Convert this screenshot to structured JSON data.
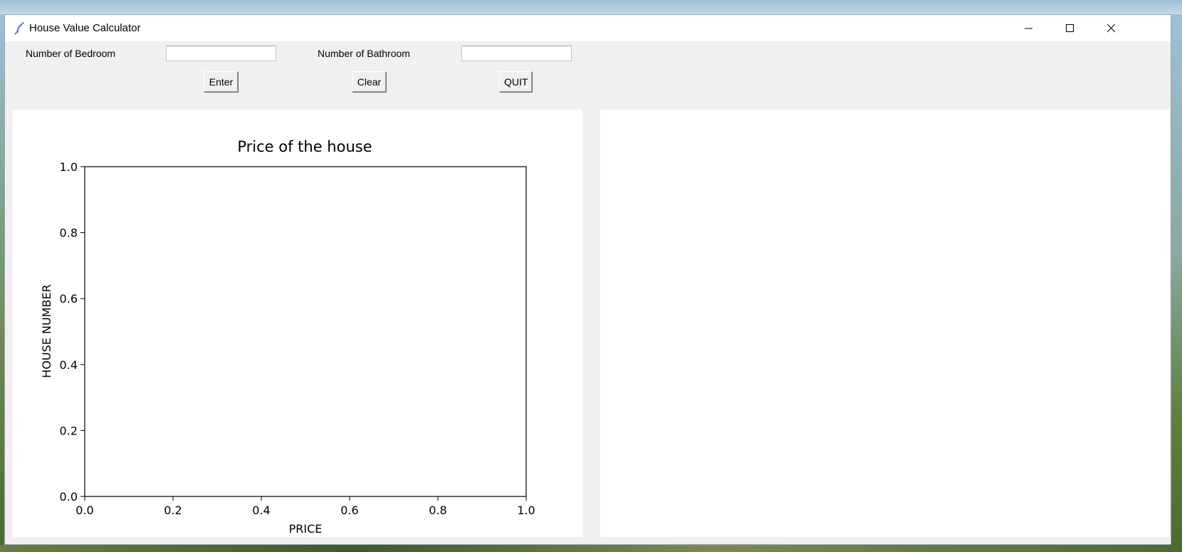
{
  "window": {
    "title": "House Value Calculator",
    "controls": [
      "minimize",
      "maximize",
      "close"
    ]
  },
  "form": {
    "bedroom_label": "Number of Bedroom",
    "bedroom_value": "",
    "bathroom_label": "Number of Bathroom",
    "bathroom_value": "",
    "enter_label": "Enter",
    "clear_label": "Clear",
    "quit_label": "QUIT"
  },
  "chart_data": {
    "type": "scatter",
    "title": "Price of the house",
    "xlabel": "PRICE",
    "ylabel": "HOUSE NUMBER",
    "xlim": [
      0.0,
      1.0
    ],
    "ylim": [
      0.0,
      1.0
    ],
    "xticks": [
      "0.0",
      "0.2",
      "0.4",
      "0.6",
      "0.8",
      "1.0"
    ],
    "yticks": [
      "0.0",
      "0.2",
      "0.4",
      "0.6",
      "0.8",
      "1.0"
    ],
    "series": [],
    "grid": false
  },
  "colors": {
    "window_bg": "#f0f0f0",
    "panel_bg": "#ffffff",
    "axis": "#000000"
  }
}
